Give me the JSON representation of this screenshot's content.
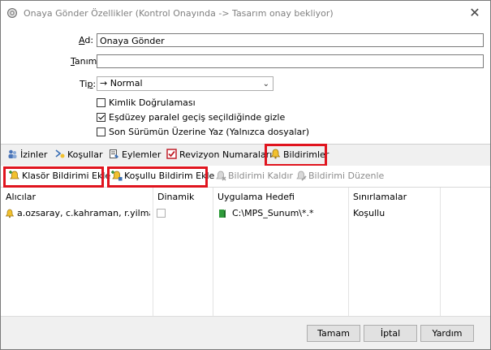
{
  "window": {
    "title": "Onaya Gönder Özellikler (Kontrol Onayında -> Tasarım onay bekliyor)",
    "close_glyph": "✕"
  },
  "form": {
    "ad_label": "Ad:",
    "ad_value": "Onaya Gönder",
    "tanim_label": "Tanım:",
    "tanim_value": "",
    "tip_label": "Tip:",
    "tip_value": "→ Normal",
    "checkboxes": [
      {
        "label": "Kimlik Doğrulaması",
        "checked": false
      },
      {
        "label": "Eşdüzey paralel geçiş seçildiğinde gizle",
        "checked": true
      },
      {
        "label": "Son Sürümün Üzerine Yaz (Yalnızca dosyalar)",
        "checked": false
      }
    ]
  },
  "tabs": [
    {
      "label": "İzinler",
      "icon": "permissions-icon"
    },
    {
      "label": "Koşullar",
      "icon": "conditions-icon"
    },
    {
      "label": "Eylemler",
      "icon": "actions-icon"
    },
    {
      "label": "Revizyon Numaraları",
      "icon": "revision-checkbox-icon"
    },
    {
      "label": "Bildirimler",
      "icon": "bell-icon",
      "active": true
    }
  ],
  "toolbar": {
    "add_folder_notification": "Klasör Bildirimi Ekle",
    "add_conditional_notification": "Koşullu Bildirim Ekle",
    "remove_notification": "Bildirimi Kaldır",
    "edit_notification": "Bildirimi Düzenle"
  },
  "grid": {
    "headers": [
      "Alıcılar",
      "Dinamik",
      "Uygulama Hedefi",
      "Sınırlamalar"
    ],
    "rows": [
      {
        "recipients": "a.ozsaray, c.kahraman, r.yilmaz, ...",
        "dynamic": false,
        "target": "C:\\MPS_Sunum\\*.*",
        "restrictions": "Koşullu"
      }
    ]
  },
  "buttons": {
    "ok": "Tamam",
    "cancel": "İptal",
    "help": "Yardım"
  },
  "colors": {
    "highlight_red": "#e0141e",
    "tabbar_bg": "#f0f0f0",
    "bell_yellow": "#f2c12e"
  }
}
